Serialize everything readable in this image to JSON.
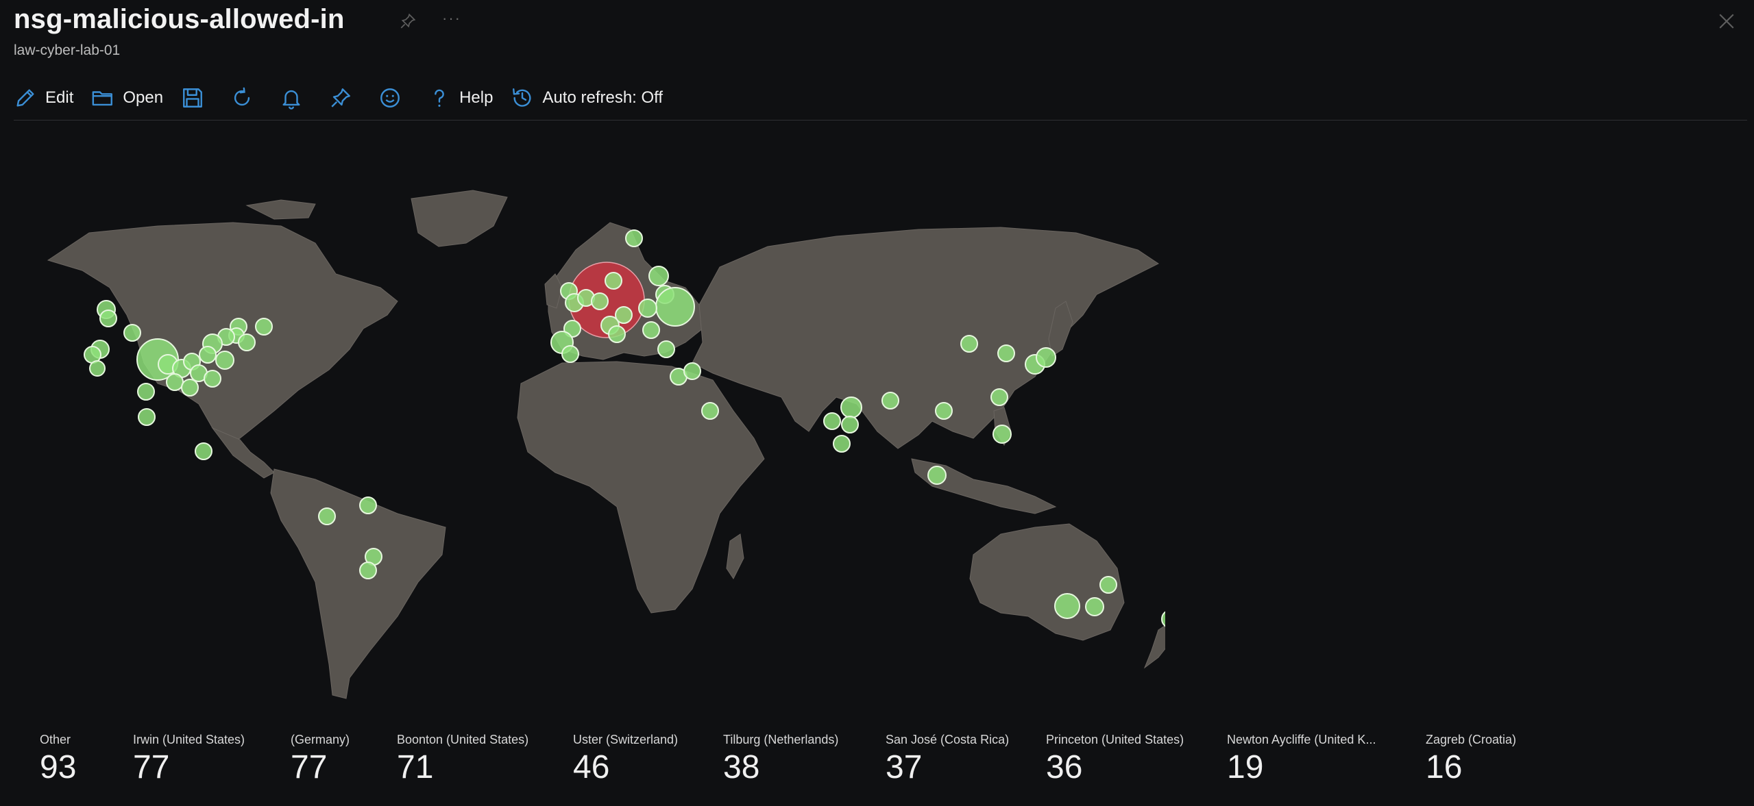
{
  "header": {
    "title": "nsg-malicious-allowed-in",
    "subtitle": "law-cyber-lab-01"
  },
  "toolbar": {
    "edit_label": "Edit",
    "open_label": "Open",
    "help_label": "Help",
    "auto_refresh_label": "Auto refresh: Off"
  },
  "colors": {
    "accent": "#3b8fd6",
    "land": "#58544f",
    "hotspot": "#c83440",
    "marker": "#8ee07a"
  },
  "stats": [
    {
      "label": "Other",
      "value": "93"
    },
    {
      "label": "Irwin (United States)",
      "value": "77"
    },
    {
      "label": "(Germany)",
      "value": "77"
    },
    {
      "label": "Boonton (United States)",
      "value": "71"
    },
    {
      "label": "Uster (Switzerland)",
      "value": "46"
    },
    {
      "label": "Tilburg (Netherlands)",
      "value": "38"
    },
    {
      "label": "San José (Costa Rica)",
      "value": "37"
    },
    {
      "label": "Princeton (United States)",
      "value": "36"
    },
    {
      "label": "Newton Aycliffe (United K...",
      "value": "19"
    },
    {
      "label": "Zagreb (Croatia)",
      "value": "16"
    }
  ]
}
